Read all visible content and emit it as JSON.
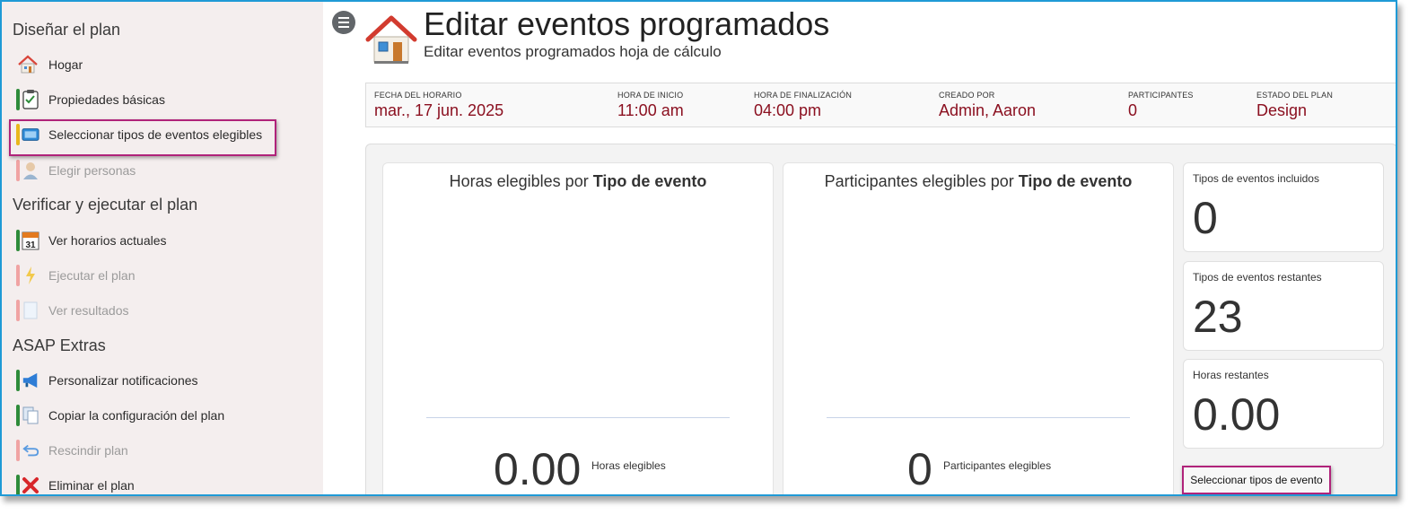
{
  "sidebar": {
    "sections": [
      {
        "title": "Diseñar el plan"
      },
      {
        "title": "Verificar y ejecutar el plan"
      },
      {
        "title": "ASAP Extras"
      }
    ],
    "items": [
      {
        "label": "Hogar",
        "icon": "house-icon",
        "disabled": false
      },
      {
        "label": "Propiedades básicas",
        "icon": "checklist-icon",
        "disabled": false
      },
      {
        "label": "Seleccionar tipos de eventos elegibles",
        "icon": "screen-icon",
        "disabled": false,
        "highlighted": true
      },
      {
        "label": "Elegir personas",
        "icon": "person-icon",
        "disabled": true
      },
      {
        "label": "Ver horarios actuales",
        "icon": "calendar-icon",
        "calendar_day": "31",
        "disabled": false
      },
      {
        "label": "Ejecutar el plan",
        "icon": "lightning-icon",
        "disabled": true
      },
      {
        "label": "Ver resultados",
        "icon": "document-icon",
        "disabled": true
      },
      {
        "label": "Personalizar notificaciones",
        "icon": "megaphone-icon",
        "disabled": false
      },
      {
        "label": "Copiar la configuración del plan",
        "icon": "copy-icon",
        "disabled": false
      },
      {
        "label": "Rescindir plan",
        "icon": "undo-arrow-icon",
        "disabled": true
      },
      {
        "label": "Eliminar el plan",
        "icon": "red-x-icon",
        "disabled": false
      }
    ]
  },
  "header": {
    "title": "Editar eventos programados",
    "subtitle": "Editar eventos programados hoja de cálculo"
  },
  "infobar": [
    {
      "label": "Fecha del horario",
      "value": "mar., 17 jun. 2025"
    },
    {
      "label": "Hora de inicio",
      "value": "11:00 am"
    },
    {
      "label": "Hora de finalización",
      "value": "04:00 pm"
    },
    {
      "label": "Creado por",
      "value": "Admin, Aaron"
    },
    {
      "label": "Participantes",
      "value": "0"
    },
    {
      "label": "Estado del plan",
      "value": "Design"
    }
  ],
  "charts": [
    {
      "title_prefix": "Horas elegibles por ",
      "title_bold": "Tipo de evento",
      "value": "0.00",
      "value_label": "Horas elegibles"
    },
    {
      "title_prefix": "Participantes elegibles por ",
      "title_bold": "Tipo de evento",
      "value": "0",
      "value_label": "Participantes elegibles"
    }
  ],
  "stats": [
    {
      "label": "Tipos de eventos incluidos",
      "value": "0"
    },
    {
      "label": "Tipos de eventos restantes",
      "value": "23"
    },
    {
      "label": "Horas restantes",
      "value": "0.00"
    }
  ],
  "select_button": "Seleccionar tipos de evento",
  "colors": {
    "accent_border": "#1f9ad6",
    "highlight": "#b0237a",
    "value_red": "#8b1020",
    "sidebar_bg": "#f4eeee"
  }
}
